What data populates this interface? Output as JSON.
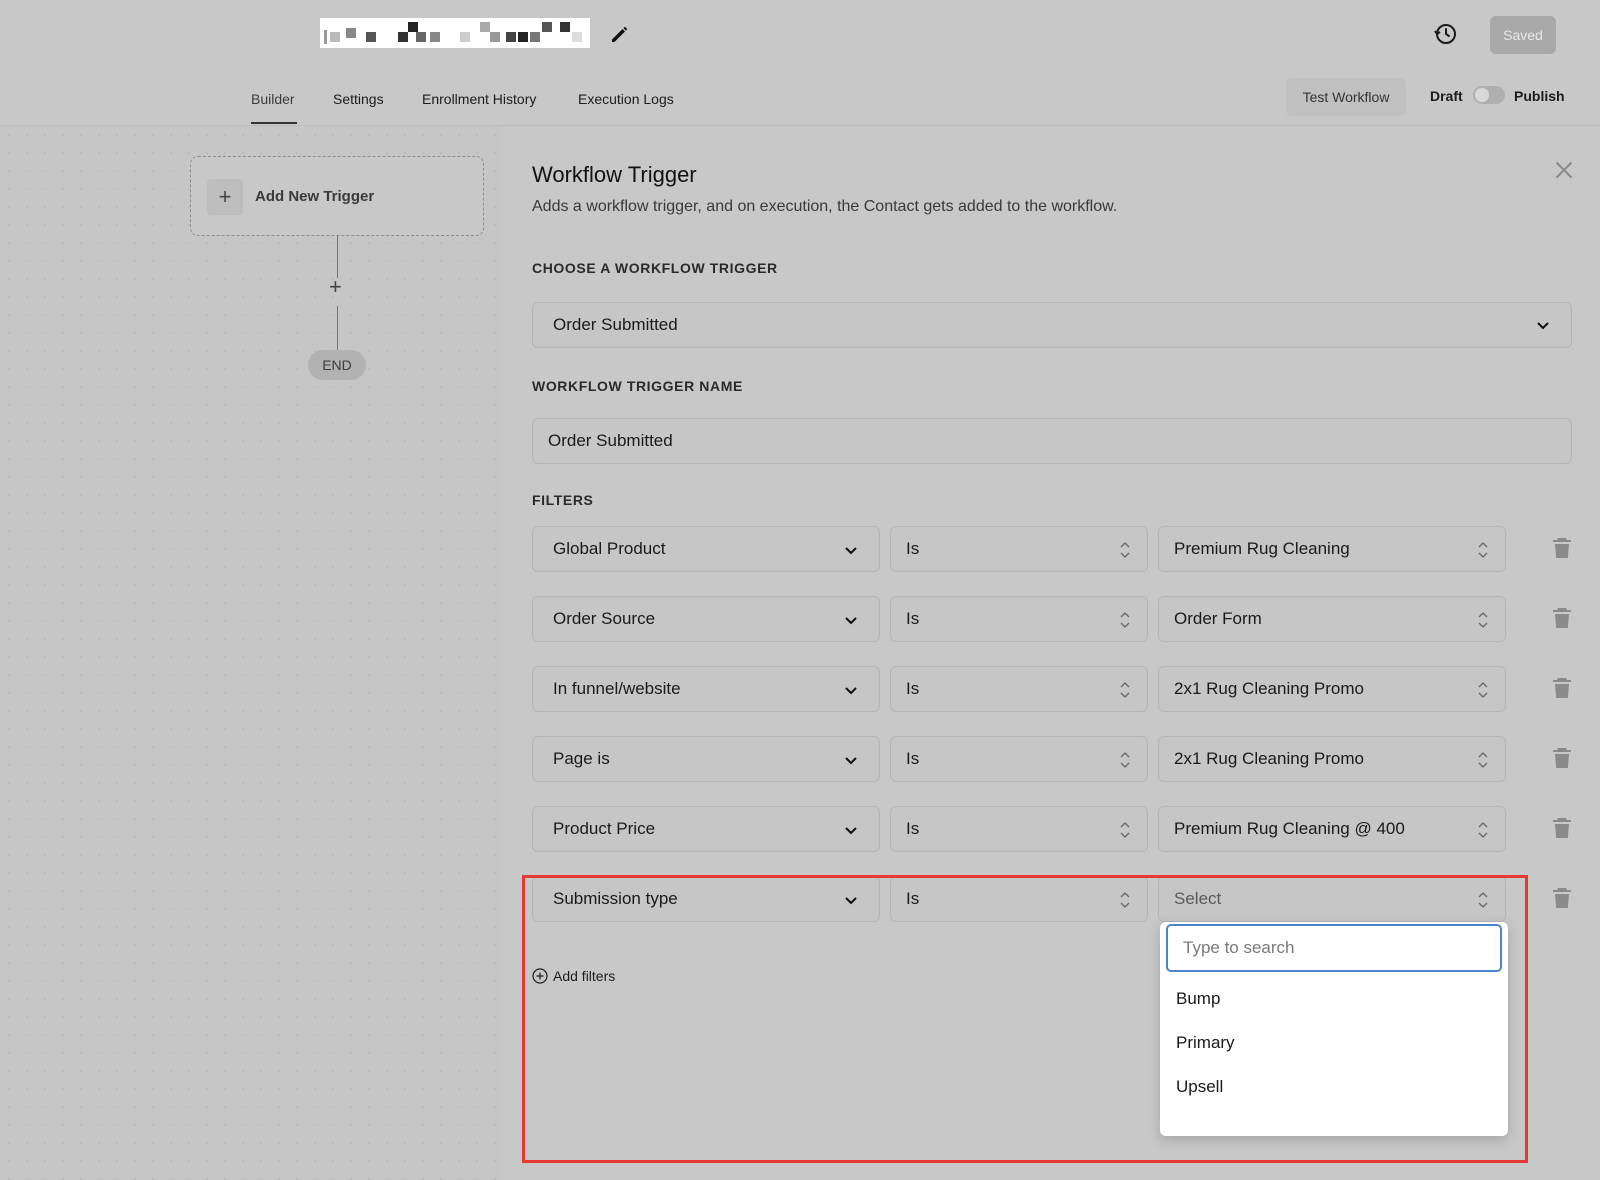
{
  "header": {
    "saved_label": "Saved"
  },
  "tabs": [
    {
      "label": "Builder"
    },
    {
      "label": "Settings"
    },
    {
      "label": "Enrollment History"
    },
    {
      "label": "Execution Logs"
    }
  ],
  "actions": {
    "test_workflow": "Test Workflow",
    "draft": "Draft",
    "publish": "Publish"
  },
  "canvas": {
    "add_trigger": "Add New Trigger",
    "plus": "+",
    "end": "END"
  },
  "panel": {
    "title": "Workflow Trigger",
    "subtitle": "Adds a workflow trigger, and on execution, the Contact gets added to the workflow.",
    "choose_label": "CHOOSE A WORKFLOW TRIGGER",
    "choose_value": "Order Submitted",
    "name_label": "WORKFLOW TRIGGER NAME",
    "name_value": "Order Submitted",
    "filters_label": "FILTERS",
    "filters": [
      {
        "field": "Global Product",
        "op": "Is",
        "value": "Premium Rug Cleaning"
      },
      {
        "field": "Order Source",
        "op": "Is",
        "value": "Order Form"
      },
      {
        "field": "In funnel/website",
        "op": "Is",
        "value": "2x1 Rug Cleaning Promo"
      },
      {
        "field": "Page is",
        "op": "Is",
        "value": "2x1 Rug Cleaning Promo"
      },
      {
        "field": "Product Price",
        "op": "Is",
        "value": "Premium Rug Cleaning @ 400"
      },
      {
        "field": "Submission type",
        "op": "Is",
        "value": "Select"
      }
    ],
    "add_filters": "Add filters"
  },
  "dropdown": {
    "search_placeholder": "Type to search",
    "options": [
      "Bump",
      "Primary",
      "Upsell"
    ]
  },
  "colors": {
    "highlight": "#e53935",
    "focus": "#4a86c8"
  }
}
